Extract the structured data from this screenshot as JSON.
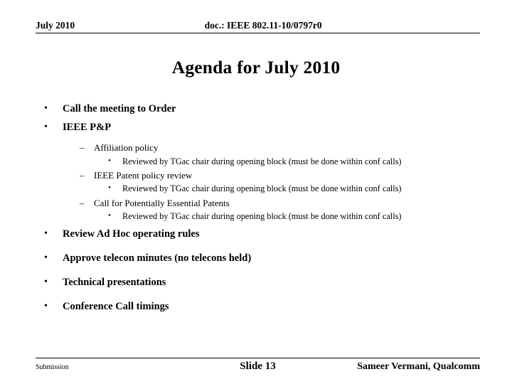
{
  "header": {
    "date": "July 2010",
    "doc": "doc.: IEEE 802.11-10/0797r0"
  },
  "title": "Agenda for July 2010",
  "bullets": {
    "b_call_order": "Call the meeting to Order",
    "b_ieee_pp": "IEEE P&P",
    "sub_affiliation": "Affiliation policy",
    "sub_patent_review": "IEEE Patent policy review",
    "sub_call_patents": "Call for Potentially Essential Patents",
    "reviewed_note": "Reviewed by TGac chair during opening block (must be done within conf calls)",
    "b_review_adhoc": "Review Ad Hoc operating rules",
    "b_approve_telecon": "Approve telecon minutes (no telecons held)",
    "b_technical": "Technical presentations",
    "b_conference": "Conference Call timings",
    "bullet_glyph_1": "•",
    "bullet_glyph_2": "–",
    "bullet_glyph_3": "•"
  },
  "footer": {
    "left": "Submission",
    "center": "Slide 13",
    "right": "Sameer Vermani, Qualcomm"
  }
}
